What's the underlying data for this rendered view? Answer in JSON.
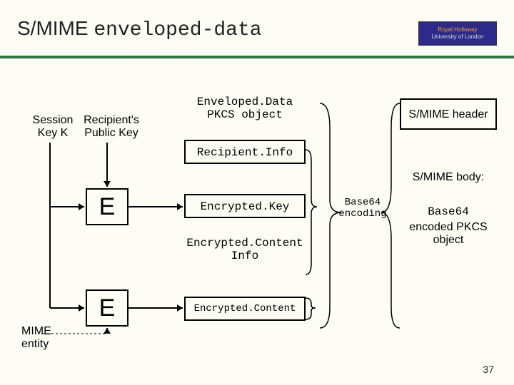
{
  "title": {
    "pre": "S/MIME ",
    "mono": "enveloped-data"
  },
  "logo": {
    "line1": "Royal Holloway",
    "line2": "University of London"
  },
  "labels": {
    "sessionKey": "Session\nKey K",
    "recipientKey": "Recipient's\nPublic Key",
    "mimeEntity": "MIME\nentity",
    "base64enc": "Base64\nencoding",
    "smimeHeader": "S/MIME header",
    "smimeBody": "S/MIME body:",
    "encodedPkcs": "encoded PKCS\nobject",
    "base64": "Base64"
  },
  "boxes": {
    "envelopedData": "Enveloped.Data\nPKCS object",
    "recipientInfo": "Recipient.Info",
    "encryptedKey": "Encrypted.Key",
    "encryptedContentInfo": "Encrypted.Content\nInfo",
    "encryptedContent": "Encrypted.Content",
    "E": "E"
  },
  "slide": 37
}
